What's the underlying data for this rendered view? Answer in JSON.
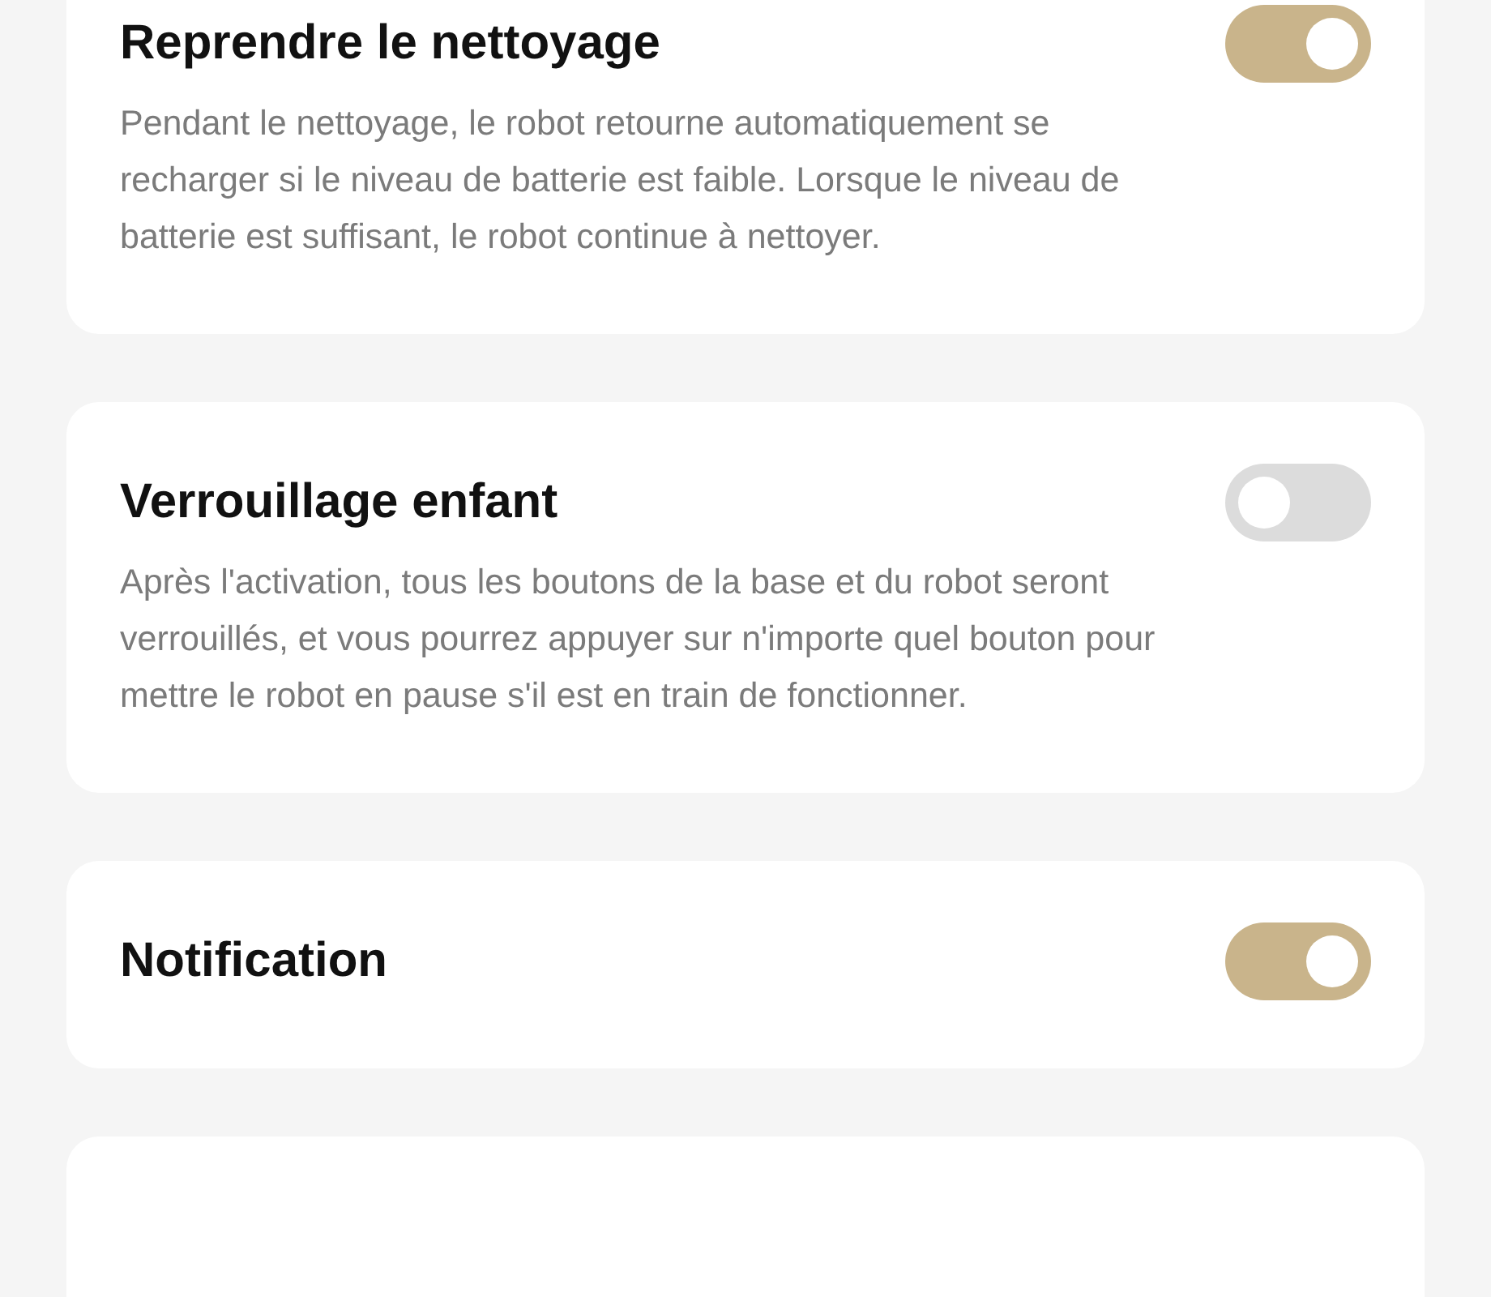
{
  "settings": [
    {
      "kind": "setting",
      "title": "Reprendre le nettoyage",
      "description": "Pendant le nettoyage, le robot retourne automatiquement se recharger si le niveau de batterie est faible. Lorsque le niveau de batterie est suffisant, le robot continue à nettoyer.",
      "on": true
    },
    {
      "kind": "setting",
      "title": "Verrouillage enfant",
      "description": "Après l'activation, tous les boutons de la base et du robot seront verrouillés, et vous pourrez appuyer sur n'importe quel bouton pour mettre le robot en pause s'il est en train de fonctionner.",
      "on": false
    },
    {
      "kind": "setting",
      "title": "Notification",
      "on": true
    },
    {
      "kind": "blank"
    }
  ]
}
